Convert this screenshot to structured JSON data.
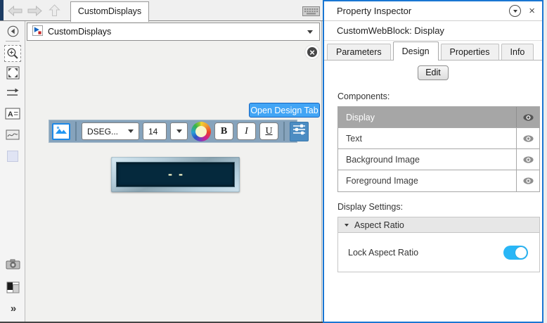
{
  "topbar": {
    "tab_label": "CustomDisplays"
  },
  "breadcrumb": {
    "model_name": "CustomDisplays"
  },
  "palette": {
    "expand_glyph": "»"
  },
  "canvas": {
    "open_design_tab_label": "Open Design Tab",
    "close_glyph": "×",
    "display_value": "--"
  },
  "format_toolbar": {
    "font_name": "DSEG...",
    "font_size": "14",
    "bold_label": "B",
    "italic_label": "I",
    "underline_label": "U"
  },
  "inspector": {
    "title": "Property Inspector",
    "close_glyph": "×",
    "block_label": "CustomWebBlock: Display",
    "tabs": [
      {
        "label": "Parameters",
        "active": false
      },
      {
        "label": "Design",
        "active": true
      },
      {
        "label": "Properties",
        "active": false
      },
      {
        "label": "Info",
        "active": false
      }
    ],
    "edit_button_label": "Edit",
    "components_label": "Components:",
    "components": [
      {
        "name": "Display",
        "selected": true
      },
      {
        "name": "Text",
        "selected": false
      },
      {
        "name": "Background Image",
        "selected": false
      },
      {
        "name": "Foreground Image",
        "selected": false
      }
    ],
    "display_settings_label": "Display Settings:",
    "aspect_section_label": "Aspect Ratio",
    "lock_aspect_label": "Lock Aspect Ratio",
    "lock_aspect_on": true
  },
  "colors": {
    "panel_accent": "#1976d2",
    "open_design_blue": "#42a5f5",
    "toolbar_bg": "#86a3bc",
    "toggle_on": "#29b6f6",
    "display_screen": "#05293d",
    "display_text": "#f5f5c8",
    "selected_row": "#a6a6a6"
  }
}
